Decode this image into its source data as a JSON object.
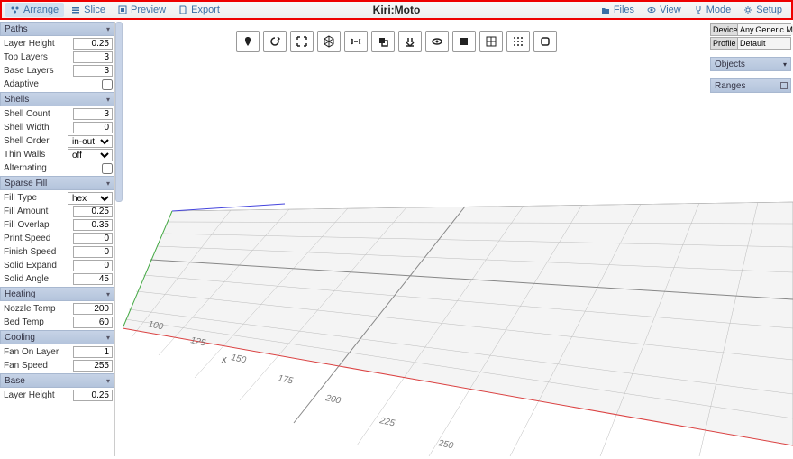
{
  "title": "Kiri:Moto",
  "topbar": {
    "left": [
      {
        "label": "Arrange",
        "icon": "arrange-icon",
        "active": true
      },
      {
        "label": "Slice",
        "icon": "slice-icon"
      },
      {
        "label": "Preview",
        "icon": "preview-icon"
      },
      {
        "label": "Export",
        "icon": "export-icon"
      }
    ],
    "right": [
      {
        "label": "Files",
        "icon": "files-icon"
      },
      {
        "label": "View",
        "icon": "view-icon"
      },
      {
        "label": "Mode",
        "icon": "mode-icon"
      },
      {
        "label": "Setup",
        "icon": "setup-icon"
      }
    ]
  },
  "panels": [
    {
      "title": "Paths",
      "rows": [
        {
          "label": "Layer Height",
          "type": "num",
          "value": "0.25"
        },
        {
          "label": "Top Layers",
          "type": "num",
          "value": "3"
        },
        {
          "label": "Base Layers",
          "type": "num",
          "value": "3"
        },
        {
          "label": "Adaptive",
          "type": "check",
          "value": false
        }
      ]
    },
    {
      "title": "Shells",
      "rows": [
        {
          "label": "Shell Count",
          "type": "num",
          "value": "3"
        },
        {
          "label": "Shell Width",
          "type": "num",
          "value": "0"
        },
        {
          "label": "Shell Order",
          "type": "select",
          "value": "in-out"
        },
        {
          "label": "Thin Walls",
          "type": "select",
          "value": "off"
        },
        {
          "label": "Alternating",
          "type": "check",
          "value": false
        }
      ]
    },
    {
      "title": "Sparse Fill",
      "rows": [
        {
          "label": "Fill Type",
          "type": "select",
          "value": "hex"
        },
        {
          "label": "Fill Amount",
          "type": "num",
          "value": "0.25"
        },
        {
          "label": "Fill Overlap",
          "type": "num",
          "value": "0.35"
        },
        {
          "label": "Print Speed",
          "type": "num",
          "value": "0"
        },
        {
          "label": "Finish Speed",
          "type": "num",
          "value": "0"
        },
        {
          "label": "Solid Expand",
          "type": "num",
          "value": "0"
        },
        {
          "label": "Solid Angle",
          "type": "num",
          "value": "45"
        }
      ]
    },
    {
      "title": "Heating",
      "rows": [
        {
          "label": "Nozzle Temp",
          "type": "num",
          "value": "200"
        },
        {
          "label": "Bed Temp",
          "type": "num",
          "value": "60"
        }
      ]
    },
    {
      "title": "Cooling",
      "rows": [
        {
          "label": "Fan On Layer",
          "type": "num",
          "value": "1"
        },
        {
          "label": "Fan Speed",
          "type": "num",
          "value": "255"
        }
      ]
    },
    {
      "title": "Base",
      "rows": [
        {
          "label": "Layer Height",
          "type": "num",
          "value": "0.25"
        }
      ]
    }
  ],
  "right": {
    "device_label": "Device",
    "device_value": "Any.Generic.Marlin",
    "profile_label": "Profile",
    "profile_value": "Default",
    "objects": "Objects",
    "ranges": "Ranges"
  },
  "axis_labels": [
    "100",
    "125",
    "150",
    "175",
    "200",
    "225",
    "250"
  ],
  "axis_letter": "x",
  "tool_icons": [
    "pin",
    "reload",
    "expand",
    "dice",
    "hflip",
    "dup",
    "down",
    "eye",
    "solid",
    "grid4",
    "dotgrid",
    "outline"
  ]
}
